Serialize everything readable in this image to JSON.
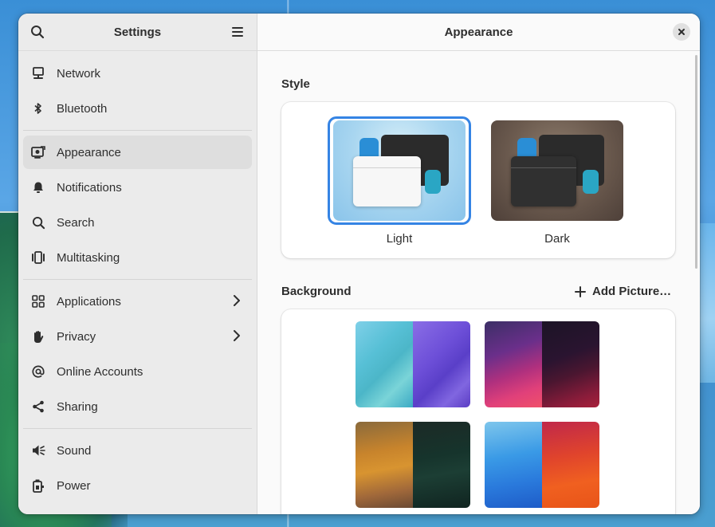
{
  "sidebar": {
    "title": "Settings",
    "items": [
      {
        "label": "Network",
        "icon": "network-icon"
      },
      {
        "label": "Bluetooth",
        "icon": "bluetooth-icon"
      },
      {
        "label": "Appearance",
        "icon": "appearance-icon",
        "active": true
      },
      {
        "label": "Notifications",
        "icon": "bell-icon"
      },
      {
        "label": "Search",
        "icon": "search-icon"
      },
      {
        "label": "Multitasking",
        "icon": "multitasking-icon"
      },
      {
        "label": "Applications",
        "icon": "applications-icon",
        "has_submenu": true
      },
      {
        "label": "Privacy",
        "icon": "hand-icon",
        "has_submenu": true
      },
      {
        "label": "Online Accounts",
        "icon": "at-sign-icon"
      },
      {
        "label": "Sharing",
        "icon": "share-icon"
      },
      {
        "label": "Sound",
        "icon": "speaker-icon"
      },
      {
        "label": "Power",
        "icon": "power-plug-icon"
      }
    ]
  },
  "content": {
    "title": "Appearance",
    "style": {
      "section_label": "Style",
      "options": [
        {
          "label": "Light",
          "selected": true
        },
        {
          "label": "Dark",
          "selected": false
        }
      ]
    },
    "background": {
      "section_label": "Background",
      "add_picture_label": "Add Picture…"
    }
  },
  "colors": {
    "accent": "#3584e4",
    "sidebar_bg": "#ebebeb",
    "content_bg": "#fafafa",
    "card_bg": "#ffffff",
    "text": "#2e2e2e"
  }
}
